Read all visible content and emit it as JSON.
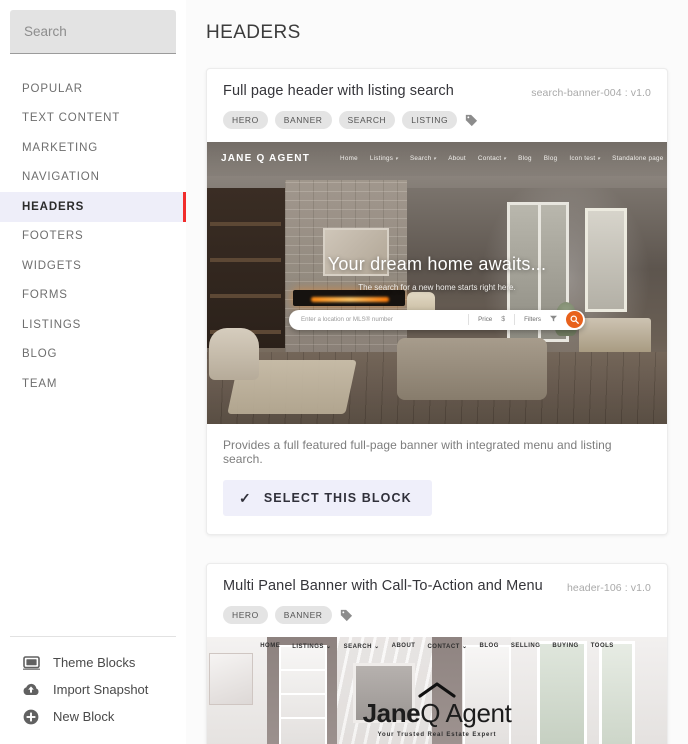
{
  "sidebar": {
    "search": {
      "placeholder": "Search",
      "value": ""
    },
    "items": [
      {
        "label": "POPULAR",
        "active": false
      },
      {
        "label": "TEXT CONTENT",
        "active": false
      },
      {
        "label": "MARKETING",
        "active": false
      },
      {
        "label": "NAVIGATION",
        "active": false
      },
      {
        "label": "HEADERS",
        "active": true
      },
      {
        "label": "FOOTERS",
        "active": false
      },
      {
        "label": "WIDGETS",
        "active": false
      },
      {
        "label": "FORMS",
        "active": false
      },
      {
        "label": "LISTINGS",
        "active": false
      },
      {
        "label": "BLOG",
        "active": false
      },
      {
        "label": "TEAM",
        "active": false
      }
    ],
    "active_accent": "#f12c2c",
    "active_background": "#eeeef9",
    "footer": [
      {
        "icon": "theme-blocks-icon",
        "label": "Theme Blocks"
      },
      {
        "icon": "cloud-upload-icon",
        "label": "Import Snapshot"
      },
      {
        "icon": "plus-circle-icon",
        "label": "New Block"
      }
    ]
  },
  "main": {
    "title": "HEADERS",
    "cards": [
      {
        "title": "Full page header with listing search",
        "meta": "search-banner-004 : v1.0",
        "chips": [
          "HERO",
          "BANNER",
          "SEARCH",
          "LISTING"
        ],
        "description": "Provides a full featured full-page banner with integrated menu and listing search.",
        "select_label": "SELECT THIS BLOCK",
        "preview": {
          "logo": "JANE Q AGENT",
          "menu": [
            {
              "label": "Home",
              "dropdown": false
            },
            {
              "label": "Listings",
              "dropdown": true
            },
            {
              "label": "Search",
              "dropdown": true
            },
            {
              "label": "About",
              "dropdown": false
            },
            {
              "label": "Contact",
              "dropdown": true
            },
            {
              "label": "Blog",
              "dropdown": false
            },
            {
              "label": "Blog",
              "dropdown": false
            },
            {
              "label": "Icon test",
              "dropdown": true
            },
            {
              "label": "Standalone page",
              "dropdown": false
            }
          ],
          "headline": "Your dream home awaits...",
          "subhead": "The search for a new home starts right here.",
          "search_placeholder": "Enter a location or MLS® number",
          "price_label": "Price",
          "price_symbol": "$",
          "filters_label": "Filters",
          "search_button_color": "#e8611c"
        }
      },
      {
        "title": "Multi Panel Banner with Call-To-Action and Menu",
        "meta": "header-106 : v1.0",
        "chips": [
          "HERO",
          "BANNER"
        ],
        "preview": {
          "menu": [
            "HOME",
            "LISTINGS ⌄",
            "SEARCH ⌄",
            "ABOUT",
            "CONTACT ⌄",
            "BLOG",
            "SELLING",
            "BUYING",
            "TOOLS"
          ],
          "brand_bold": "Jane",
          "brand_light": "Q Agent",
          "tagline": "Your Trusted Real Estate Expert"
        }
      }
    ]
  }
}
